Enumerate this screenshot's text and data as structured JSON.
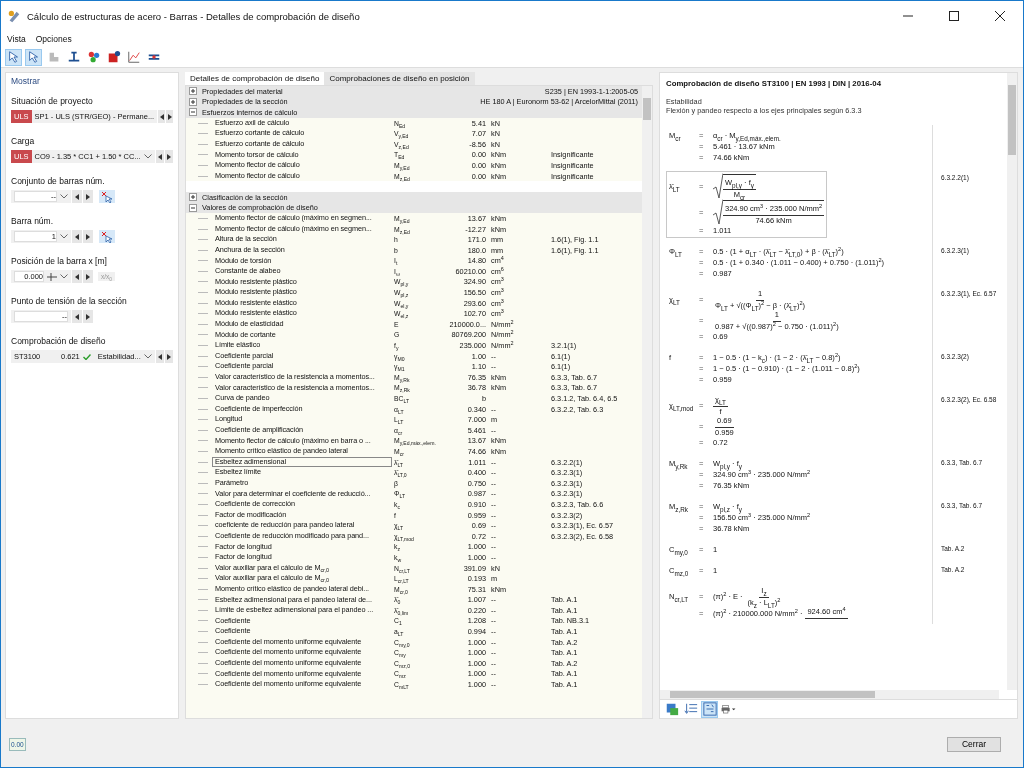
{
  "window": {
    "title": "Cálculo de estructuras de acero - Barras - Detalles de comprobación de diseño"
  },
  "menu": [
    "Vista",
    "Opciones"
  ],
  "toolbar": [
    {
      "selected": true
    },
    {
      "selected": true
    },
    {
      "selected": false
    },
    {
      "selected": false
    },
    {
      "selected": false
    },
    {
      "selected": false
    },
    {
      "selected": false
    },
    {
      "selected": false
    }
  ],
  "left_panel": {
    "header": "Mostrar",
    "fields": [
      {
        "kind": "select",
        "label": "Situación de proyecto",
        "badge": "ULS",
        "value": "SP1 - ULS (STR/GEO) - Permane...",
        "caret": false,
        "position_icon": false
      },
      {
        "kind": "select",
        "label": "Carga",
        "badge": "ULS",
        "value": "CO9 - 1.35 * CC1 + 1.50 * CC...",
        "caret": true,
        "position_icon": false
      },
      {
        "kind": "select",
        "label": "Conjunto de barras núm.",
        "value": "--",
        "caret": true,
        "pick": true,
        "position_icon": false
      },
      {
        "kind": "select",
        "label": "Barra núm.",
        "value": "1",
        "caret": true,
        "pick": true,
        "position_icon": false
      },
      {
        "kind": "select",
        "label": "Posición de la barra x [m]",
        "value": "0.000",
        "caret": true,
        "position_icon": true,
        "ratio_button": {
          "text": "x/x$_{0}$",
          "disabled": true
        }
      },
      {
        "kind": "select",
        "label": "Punto de tensión de la sección",
        "value": "--",
        "caret": false,
        "position_icon": false
      },
      {
        "kind": "check",
        "label": "Comprobación de diseño",
        "id": "ST3100",
        "ratio": "0.621",
        "ok": true,
        "value": "Estabilidad...",
        "caret": true
      }
    ]
  },
  "tabs": [
    {
      "label": "Detalles de comprobación de diseño",
      "selected": true
    },
    {
      "label": "Comprobaciones de diseño en posición",
      "selected": false
    }
  ],
  "table": {
    "groups": [
      {
        "title": "Propiedades del material",
        "info": "S235 | EN 1993-1-1:2005-05",
        "expanded": false
      },
      {
        "title": "Propiedades de la sección",
        "info": "HE 180 A | Euronorm 53-62 | ArcelorMittal (2011)",
        "expanded": false
      },
      {
        "title": "Esfuerzos internos de cálculo",
        "expanded": true,
        "rows": [
          {
            "desc": "Esfuerzo axil de cálculo",
            "sym": "N$_{Ed}$",
            "value": "5.41",
            "unit": "kN",
            "selected": false
          },
          {
            "desc": "Esfuerzo cortante de cálculo",
            "sym": "V$_{y,Ed}$",
            "value": "7.07",
            "unit": "kN",
            "selected": false
          },
          {
            "desc": "Esfuerzo cortante de cálculo",
            "sym": "V$_{z,Ed}$",
            "value": "-8.56",
            "unit": "kN",
            "selected": false
          },
          {
            "desc": "Momento torsor de cálculo",
            "sym": "T$_{Ed}$",
            "value": "0.00",
            "unit": "kNm",
            "ref": "Insignificante",
            "selected": false
          },
          {
            "desc": "Momento flector de cálculo",
            "sym": "M$_{y,Ed}$",
            "value": "0.00",
            "unit": "kNm",
            "ref": "Insignificante",
            "selected": false
          },
          {
            "desc": "Momento flector de cálculo",
            "sym": "M$_{z,Ed}$",
            "value": "0.00",
            "unit": "kNm",
            "ref": "Insignificante",
            "selected": false
          }
        ]
      },
      {
        "title": "Clasificación de la sección",
        "expanded": false
      },
      {
        "title": "Valores de comprobación de diseño",
        "expanded": true,
        "rows": [
          {
            "desc": "Momento flector de cálculo (máximo en segmen...",
            "sym": "M$_{y,Ed}$",
            "value": "13.67",
            "unit": "kNm",
            "selected": false
          },
          {
            "desc": "Momento flector de cálculo (máximo en segmen...",
            "sym": "M$_{z,Ed}$",
            "value": "-12.27",
            "unit": "kNm",
            "selected": false
          },
          {
            "desc": "Altura de la sección",
            "sym": "h",
            "value": "171.0",
            "unit": "mm",
            "ref": "1.6(1), Fig. 1.1",
            "selected": false
          },
          {
            "desc": "Anchura de la sección",
            "sym": "b",
            "value": "180.0",
            "unit": "mm",
            "ref": "1.6(1), Fig. 1.1",
            "selected": false
          },
          {
            "desc": "Módulo de torsión",
            "sym": "I$_{t}$",
            "value": "14.80",
            "unit": "cm$^{4}$",
            "selected": false
          },
          {
            "desc": "Constante de alabeo",
            "sym": "I$_{ω}$",
            "value": "60210.00",
            "unit": "cm$^{6}$",
            "selected": false
          },
          {
            "desc": "Módulo resistente plástico",
            "sym": "W$_{pl,y}$",
            "value": "324.90",
            "unit": "cm$^{3}$",
            "selected": false
          },
          {
            "desc": "Módulo resistente plástico",
            "sym": "W$_{pl,z}$",
            "value": "156.50",
            "unit": "cm$^{3}$",
            "selected": false
          },
          {
            "desc": "Módulo resistente elástico",
            "sym": "W$_{el,y}$",
            "value": "293.60",
            "unit": "cm$^{3}$",
            "selected": false
          },
          {
            "desc": "Módulo resistente elástico",
            "sym": "W$_{el,z}$",
            "value": "102.70",
            "unit": "cm$^{3}$",
            "selected": false
          },
          {
            "desc": "Módulo de elasticidad",
            "sym": "E",
            "value": "210000.0...",
            "unit": "N/mm$^{2}$",
            "selected": false
          },
          {
            "desc": "Módulo de cortante",
            "sym": "G",
            "value": "80769.200",
            "unit": "N/mm$^{2}$",
            "selected": false
          },
          {
            "desc": "Límite elástico",
            "sym": "f$_{y}$",
            "value": "235.000",
            "unit": "N/mm$^{2}$",
            "ref": "3.2.1(1)",
            "selected": false
          },
          {
            "desc": "Coeficiente parcial",
            "sym": "γ$_{M0}$",
            "value": "1.00",
            "unit": "--",
            "ref": "6.1(1)",
            "selected": false
          },
          {
            "desc": "Coeficiente parcial",
            "sym": "γ$_{M1}$",
            "value": "1.10",
            "unit": "--",
            "ref": "6.1(1)",
            "selected": false
          },
          {
            "desc": "Valor característico de la resistencia a momentos...",
            "sym": "M$_{y,Rk}$",
            "value": "76.35",
            "unit": "kNm",
            "ref": "6.3.3, Tab. 6.7",
            "selected": false
          },
          {
            "desc": "Valor característico de la resistencia a momentos...",
            "sym": "M$_{z,Rk}$",
            "value": "36.78",
            "unit": "kNm",
            "ref": "6.3.3, Tab. 6.7",
            "selected": false
          },
          {
            "desc": "Curva de pandeo",
            "sym": "BC$_{LT}$",
            "value": "b",
            "ref": "6.3.1.2, Tab. 6.4, 6.5",
            "selected": false
          },
          {
            "desc": "Coeficiente de imperfección",
            "sym": "α$_{LT}$",
            "value": "0.340",
            "unit": "--",
            "ref": "6.3.2.2, Tab. 6.3",
            "selected": false
          },
          {
            "desc": "Longitud",
            "sym": "L$_{LT}$",
            "value": "7.000",
            "unit": "m",
            "selected": false
          },
          {
            "desc": "Coeficiente de amplificación",
            "sym": "α$_{cr}$",
            "value": "5.461",
            "unit": "--",
            "selected": false
          },
          {
            "desc": "Momento flector de cálculo (máximo en barra o ...",
            "sym": "M$_{y,Ed,máx.,elem.}$",
            "value": "13.67",
            "unit": "kNm",
            "selected": false
          },
          {
            "desc": "Momento crítico elástico de pandeo lateral",
            "sym": "M$_{cr}$",
            "value": "74.66",
            "unit": "kNm",
            "selected": false
          },
          {
            "desc": "Esbeltez adimensional",
            "sym": "λ̄$_{LT}$",
            "value": "1.011",
            "unit": "--",
            "ref": "6.3.2.2(1)",
            "selected": true
          },
          {
            "desc": "Esbeltez límite",
            "sym": "λ̄$_{LT,0}$",
            "value": "0.400",
            "unit": "--",
            "ref": "6.3.2.3(1)",
            "selected": false
          },
          {
            "desc": "Parámetro",
            "sym": "β",
            "value": "0.750",
            "unit": "--",
            "ref": "6.3.2.3(1)",
            "selected": false
          },
          {
            "desc": "Valor para determinar el coeficiente de reducció...",
            "sym": "Φ$_{LT}$",
            "value": "0.987",
            "unit": "--",
            "ref": "6.3.2.3(1)",
            "selected": false
          },
          {
            "desc": "Coeficiente de corrección",
            "sym": "k$_{c}$",
            "value": "0.910",
            "unit": "--",
            "ref": "6.3.2.3, Tab. 6.6",
            "selected": false
          },
          {
            "desc": "Factor de modificación",
            "sym": "f",
            "value": "0.959",
            "unit": "--",
            "ref": "6.3.2.3(2)",
            "selected": false
          },
          {
            "desc": "coeficiente de reducción para pandeo lateral",
            "sym": "χ$_{LT}$",
            "value": "0.69",
            "unit": "--",
            "ref": "6.3.2.3(1), Ec. 6.57",
            "selected": false
          },
          {
            "desc": "Coeficiente de reducción modificado para pand...",
            "sym": "χ$_{LT,mod}$",
            "value": "0.72",
            "unit": "--",
            "ref": "6.3.2.3(2), Ec. 6.58",
            "selected": false
          },
          {
            "desc": "Factor de longitud",
            "sym": "k$_{z}$",
            "value": "1.000",
            "unit": "--",
            "selected": false
          },
          {
            "desc": "Factor de longitud",
            "sym": "k$_{w}$",
            "value": "1.000",
            "unit": "--",
            "selected": false
          },
          {
            "desc": "Valor auxiliar para el cálculo de M$_{cr,0}$",
            "sym": "N$_{cr,LT}$",
            "value": "391.09",
            "unit": "kN",
            "selected": false
          },
          {
            "desc": "Valor auxiliar para el cálculo de M$_{cr,0}$",
            "sym": "L$_{cr,LT}$",
            "value": "0.193",
            "unit": "m",
            "selected": false
          },
          {
            "desc": "Momento crítico elástico de pandeo lateral debi...",
            "sym": "M$_{cr,0}$",
            "value": "75.31",
            "unit": "kNm",
            "selected": false
          },
          {
            "desc": "Esbeltez adimensional para el pandeo lateral de...",
            "sym": "λ̄$_{0}$",
            "value": "1.007",
            "unit": "--",
            "ref": "Tab. A.1",
            "selected": false
          },
          {
            "desc": "Límite de esbeltez adimensional para el pandeo ...",
            "sym": "λ̄$_{0,lim}$",
            "value": "0.220",
            "unit": "--",
            "ref": "Tab. A.1",
            "selected": false
          },
          {
            "desc": "Coeficiente",
            "sym": "C$_{1}$",
            "value": "1.208",
            "unit": "--",
            "ref": "Tab. NB.3.1",
            "selected": false
          },
          {
            "desc": "Coeficiente",
            "sym": "a$_{LT}$",
            "value": "0.994",
            "unit": "--",
            "ref": "Tab. A.1",
            "selected": false
          },
          {
            "desc": "Coeficiente del momento uniforme equivalente",
            "sym": "C$_{my,0}$",
            "value": "1.000",
            "unit": "--",
            "ref": "Tab. A.2",
            "selected": false
          },
          {
            "desc": "Coeficiente del momento uniforme equivalente",
            "sym": "C$_{my}$",
            "value": "1.000",
            "unit": "--",
            "ref": "Tab. A.1",
            "selected": false
          },
          {
            "desc": "Coeficiente del momento uniforme equivalente",
            "sym": "C$_{mz,0}$",
            "value": "1.000",
            "unit": "--",
            "ref": "Tab. A.2",
            "selected": false
          },
          {
            "desc": "Coeficiente del momento uniforme equivalente",
            "sym": "C$_{mz}$",
            "value": "1.000",
            "unit": "--",
            "ref": "Tab. A.1",
            "selected": false
          },
          {
            "desc": "Coeficiente del momento uniforme equivalente",
            "sym": "C$_{mLT}$",
            "value": "1.000",
            "unit": "--",
            "ref": "Tab. A.1",
            "selected": false
          }
        ]
      }
    ]
  },
  "report": {
    "title": "Comprobación de diseño ST3100 | EN 1993 | DIN | 2016-04",
    "subtitle": "Estabilidad",
    "description": "Flexión y pandeo respecto a los ejes principales según 6.3.3",
    "formulas": [
      {
        "symbol": "M$_{cr}$",
        "highlighted": false,
        "lines": [
          {
            "kind": "plain",
            "eq": "=",
            "text": "α$_{cr}$ · M$_{y,Ed,máx.,elem.}$"
          },
          {
            "kind": "plain",
            "eq": "=",
            "text": "5.461 · 13.67 kNm"
          },
          {
            "kind": "plain",
            "eq": "=",
            "text": "74.66 kNm"
          }
        ]
      },
      {
        "symbol": "λ̄$_{LT}$",
        "ref": "6.3.2.2(1)",
        "highlighted": true,
        "lines": [
          {
            "kind": "sqrt",
            "eq": "=",
            "num": "W$_{pl,y}$ · f$_{y}$",
            "den": "M$_{cr}$"
          },
          {
            "kind": "sqrt",
            "eq": "=",
            "num": "324.90 cm$^{3}$ · 235.000 N/mm$^{2}$",
            "den": "74.66 kNm"
          },
          {
            "kind": "plain",
            "eq": "=",
            "text": "1.011"
          }
        ]
      },
      {
        "symbol": "Φ$_{LT}$",
        "ref": "6.3.2.3(1)",
        "highlighted": false,
        "lines": [
          {
            "kind": "plain",
            "eq": "=",
            "text": "0.5 · (1 + α$_{LT}$ · (λ̄$_{LT}$ − λ̄$_{LT,0}$) + β · (λ̄$_{LT}$)$^{2}$)"
          },
          {
            "kind": "plain",
            "eq": "=",
            "text": "0.5 · (1 + 0.340 · (1.011 − 0.400) + 0.750 · (1.011)$^{2}$)"
          },
          {
            "kind": "plain",
            "eq": "=",
            "text": "0.987"
          }
        ]
      },
      {
        "symbol": "χ$_{LT}$",
        "ref": "6.3.2.3(1), Ec. 6.57",
        "highlighted": false,
        "lines": [
          {
            "kind": "frac",
            "eq": "=",
            "num": "1",
            "den": "Φ$_{LT}$ + √((Φ$_{LT}$)$^{2}$ − β · (λ̄$_{LT}$)$^{2}$)"
          },
          {
            "kind": "frac",
            "eq": "=",
            "num": "1",
            "den": "0.987 + √((0.987)$^{2}$ − 0.750 · (1.011)$^{2}$)"
          },
          {
            "kind": "plain",
            "eq": "=",
            "text": "0.69"
          }
        ]
      },
      {
        "symbol": "f",
        "ref": "6.3.2.3(2)",
        "highlighted": false,
        "lines": [
          {
            "kind": "plain",
            "eq": "=",
            "text": "1 − 0.5 · (1 − k$_{c}$) · (1 − 2 · (λ̄$_{LT}$ − 0.8)$^{2}$)"
          },
          {
            "kind": "plain",
            "eq": "=",
            "text": "1 − 0.5 · (1 − 0.910) · (1 − 2 · (1.011 − 0.8)$^{2}$)"
          },
          {
            "kind": "plain",
            "eq": "=",
            "text": "0.959"
          }
        ]
      },
      {
        "symbol": "χ$_{LT,mod}$",
        "ref": "6.3.2.3(2), Ec. 6.58",
        "highlighted": false,
        "lines": [
          {
            "kind": "frac",
            "eq": "=",
            "num": "χ$_{LT}$",
            "den": "f"
          },
          {
            "kind": "frac",
            "eq": "=",
            "num": "0.69",
            "den": "0.959"
          },
          {
            "kind": "plain",
            "eq": "=",
            "text": "0.72"
          }
        ]
      },
      {
        "symbol": "M$_{y,Rk}$",
        "ref": "6.3.3, Tab. 6.7",
        "highlighted": false,
        "lines": [
          {
            "kind": "plain",
            "eq": "=",
            "text": "W$_{pl,y}$ · f$_{y}$"
          },
          {
            "kind": "plain",
            "eq": "=",
            "text": "324.90 cm$^{3}$ · 235.000 N/mm$^{2}$"
          },
          {
            "kind": "plain",
            "eq": "=",
            "text": "76.35 kNm"
          }
        ]
      },
      {
        "symbol": "M$_{z,Rk}$",
        "ref": "6.3.3, Tab. 6.7",
        "highlighted": false,
        "lines": [
          {
            "kind": "plain",
            "eq": "=",
            "text": "W$_{pl,z}$ · f$_{y}$"
          },
          {
            "kind": "plain",
            "eq": "=",
            "text": "156.50 cm$^{3}$ · 235.000 N/mm$^{2}$"
          },
          {
            "kind": "plain",
            "eq": "=",
            "text": "36.78 kNm"
          }
        ]
      },
      {
        "symbol": "C$_{my,0}$",
        "ref": "Tab. A.2",
        "highlighted": false,
        "lines": [
          {
            "kind": "plain",
            "eq": "=",
            "text": "1"
          }
        ]
      },
      {
        "symbol": "C$_{mz,0}$",
        "ref": "Tab. A.2",
        "highlighted": false,
        "lines": [
          {
            "kind": "plain",
            "eq": "=",
            "text": "1"
          }
        ]
      },
      {
        "symbol": "N$_{cr,LT}$",
        "highlighted": false,
        "lines": [
          {
            "kind": "frac",
            "eq": "=",
            "prefix": "(π)$^{2}$ · E ·",
            "num": "I$_{z}$",
            "den": "(k$_{z}$ · L$_{LT}$)$^{2}$"
          },
          {
            "kind": "frac",
            "eq": "=",
            "prefix": "(π)$^{2}$ · 210000.000 N/mm$^{2}$ ·",
            "num": "924.60 cm$^{4}$"
          }
        ]
      }
    ],
    "toolbar": [
      {
        "selected": false
      },
      {
        "selected": false
      },
      {
        "selected": true
      },
      {
        "selected": false
      }
    ]
  },
  "footer": {
    "decimals": "0.00",
    "close": "Cerrar"
  }
}
